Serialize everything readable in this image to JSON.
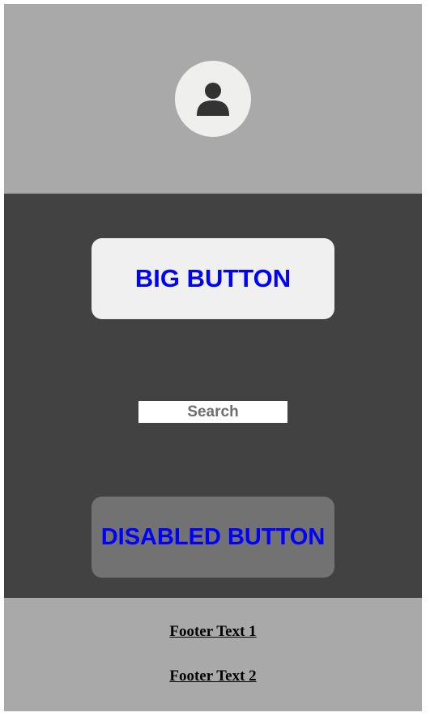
{
  "header": {
    "avatar_icon": "user-avatar-icon"
  },
  "main": {
    "big_button_label": "BIG BUTTON",
    "search_placeholder": "Search",
    "search_value": "",
    "disabled_button_label": "DISABLED BUTTON",
    "disabled_button_enabled": false
  },
  "footer": {
    "links": [
      "Footer Text 1",
      "Footer Text 2"
    ]
  },
  "colors": {
    "header_bg": "#a9a9a9",
    "main_bg": "#424242",
    "footer_bg": "#a9a9a9",
    "avatar_bg": "#efefed",
    "avatar_icon": "#333333",
    "button_bg": "#f0f0f0",
    "disabled_button_bg": "#727272",
    "button_text": "#0000ff"
  }
}
